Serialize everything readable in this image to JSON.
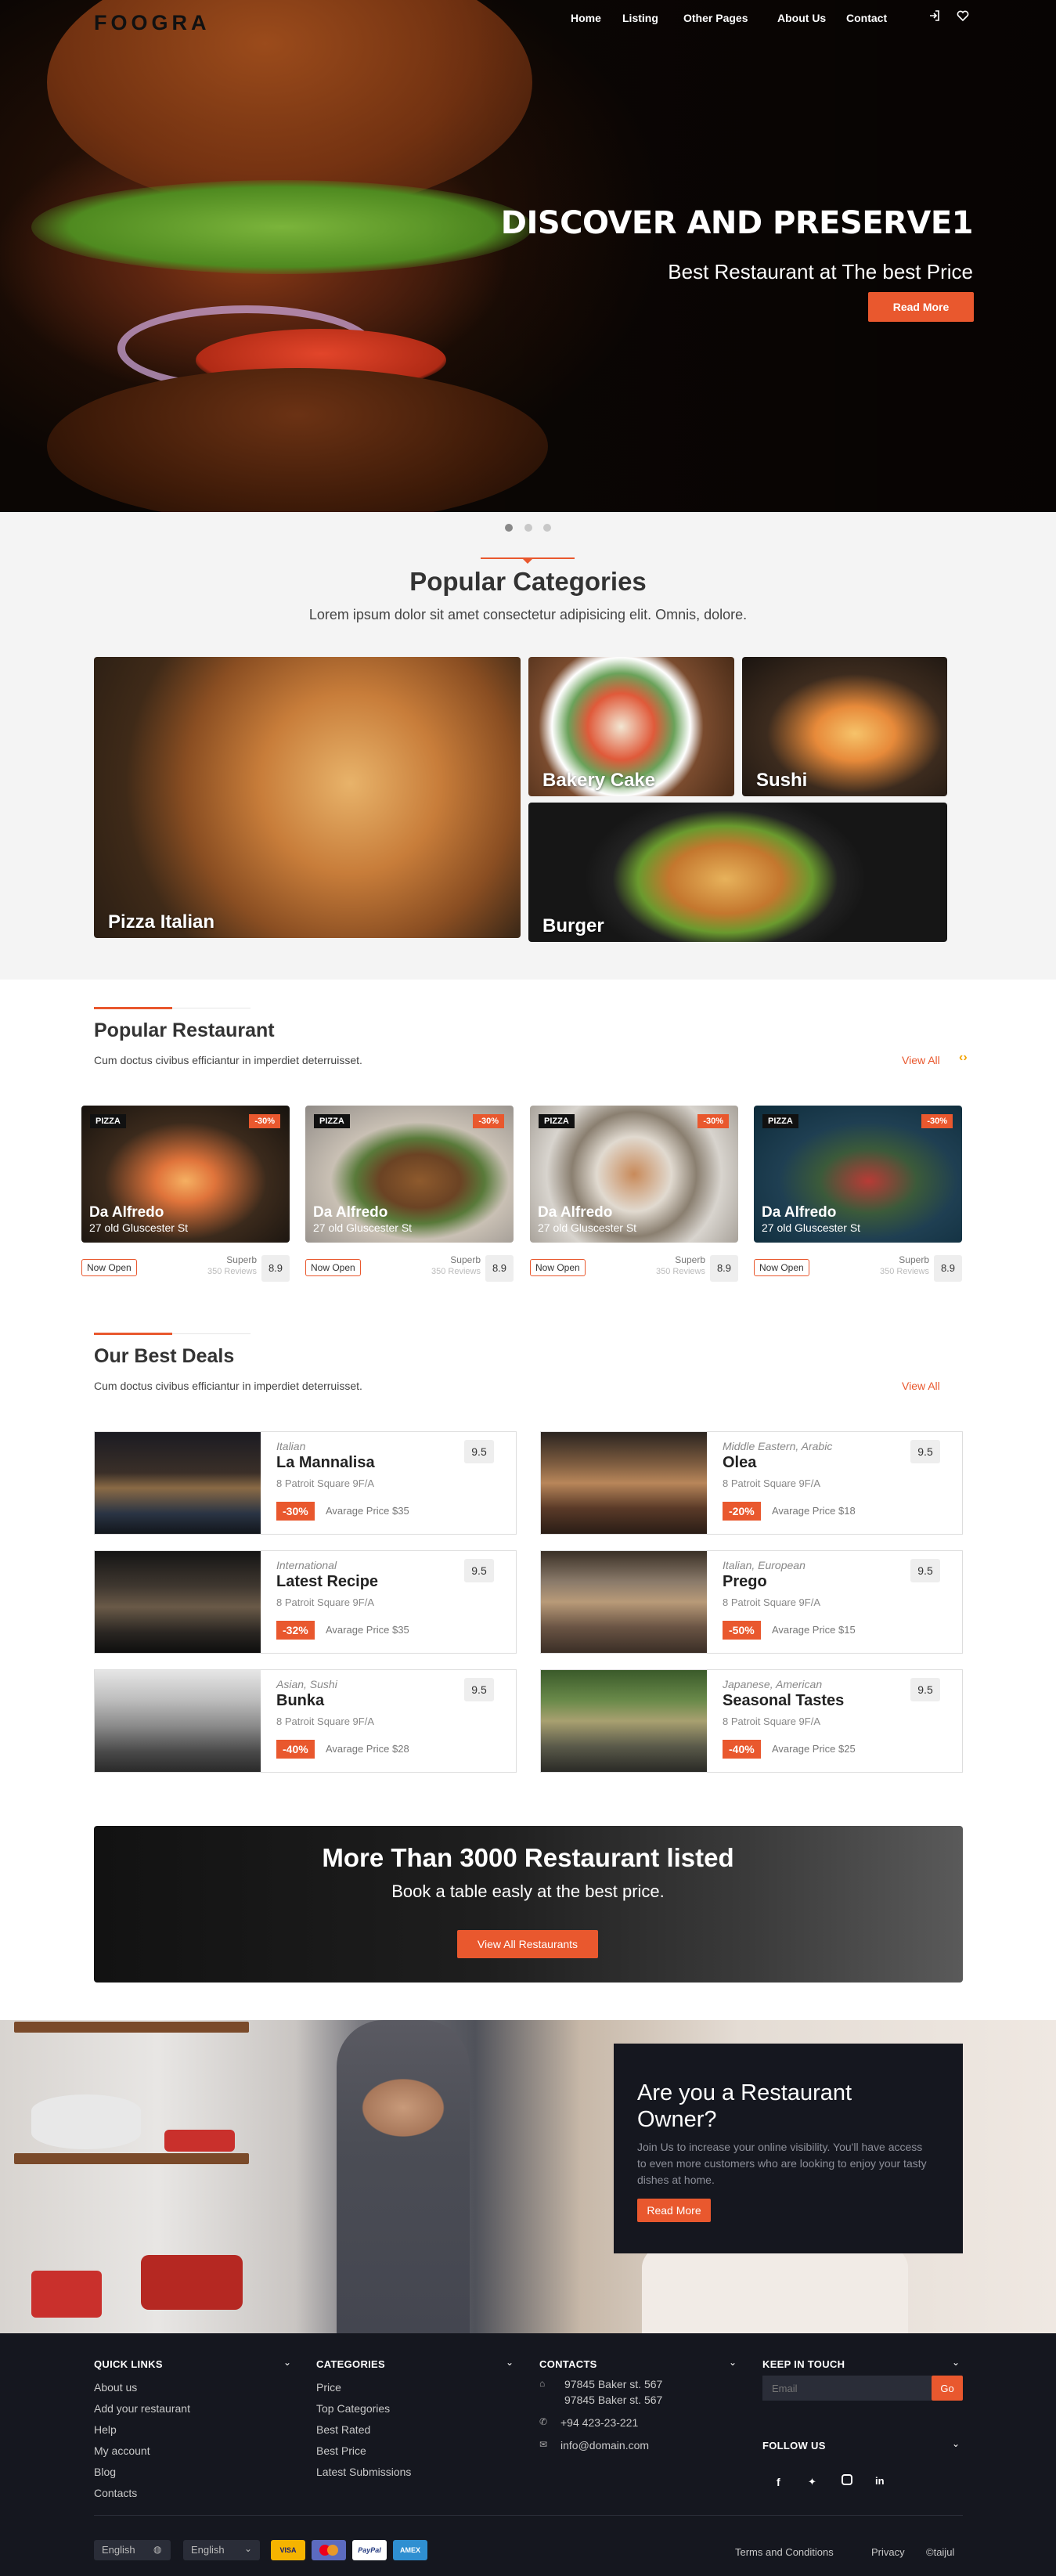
{
  "brand": "FOOGRA",
  "nav": {
    "items": [
      "Home",
      "Listing",
      "Other Pages",
      "About Us",
      "Contact"
    ]
  },
  "hero": {
    "title": "DISCOVER AND PRESERVE1",
    "subtitle": "Best Restaurant at The best Price",
    "button": "Read More"
  },
  "categories": {
    "title": "Popular Categories",
    "subtitle": "Lorem ipsum dolor sit amet consectetur adipisicing elit. Omnis, dolore.",
    "tiles": [
      "Pizza Italian",
      "Bakery Cake",
      "Sushi",
      "Burger"
    ]
  },
  "popular": {
    "title": "Popular Restaurant",
    "subtitle": "Cum doctus civibus efficiantur in imperdiet deterruisset.",
    "view_all": "View All",
    "cards": [
      {
        "tag": "PIZZA",
        "discount": "-30%",
        "name": "Da Alfredo",
        "address": "27 old Gluscester St",
        "status": "Now Open",
        "quality": "Superb",
        "reviews": "350 Reviews",
        "score": "8.9"
      },
      {
        "tag": "PIZZA",
        "discount": "-30%",
        "name": "Da Alfredo",
        "address": "27 old Gluscester St",
        "status": "Now Open",
        "quality": "Superb",
        "reviews": "350 Reviews",
        "score": "8.9"
      },
      {
        "tag": "PIZZA",
        "discount": "-30%",
        "name": "Da Alfredo",
        "address": "27 old Gluscester St",
        "status": "Now Open",
        "quality": "Superb",
        "reviews": "350 Reviews",
        "score": "8.9"
      },
      {
        "tag": "PIZZA",
        "discount": "-30%",
        "name": "Da Alfredo",
        "address": "27 old Gluscester St",
        "status": "Now Open",
        "quality": "Superb",
        "reviews": "350 Reviews",
        "score": "8.9"
      }
    ]
  },
  "deals": {
    "title": "Our Best Deals",
    "subtitle": "Cum doctus civibus efficiantur in imperdiet deterruisset.",
    "view_all": "View All",
    "items": [
      {
        "category": "Italian",
        "name": "La Mannalisa",
        "address": "8 Patroit Square 9F/A",
        "discount": "-30%",
        "price": "Avarage Price $35",
        "score": "9.5"
      },
      {
        "category": "Middle Eastern, Arabic",
        "name": "Olea",
        "address": "8 Patroit Square 9F/A",
        "discount": "-20%",
        "price": "Avarage Price $18",
        "score": "9.5"
      },
      {
        "category": "International",
        "name": "Latest Recipe",
        "address": "8 Patroit Square 9F/A",
        "discount": "-32%",
        "price": "Avarage Price $35",
        "score": "9.5"
      },
      {
        "category": "Italian, European",
        "name": "Prego",
        "address": "8 Patroit Square 9F/A",
        "discount": "-50%",
        "price": "Avarage Price $15",
        "score": "9.5"
      },
      {
        "category": "Asian, Sushi",
        "name": "Bunka",
        "address": "8 Patroit Square 9F/A",
        "discount": "-40%",
        "price": "Avarage Price $28",
        "score": "9.5"
      },
      {
        "category": "Japanese, American",
        "name": "Seasonal Tastes",
        "address": "8 Patroit Square 9F/A",
        "discount": "-40%",
        "price": "Avarage Price $25",
        "score": "9.5"
      }
    ]
  },
  "banner": {
    "title": "More Than 3000 Restaurant listed",
    "subtitle": "Book a table easly at the best price.",
    "button": "View All Restaurants"
  },
  "owner": {
    "title": "Are you a Restaurant Owner?",
    "text": "Join Us to increase your online visibility. You'll have access to even more customers who are looking to enjoy your tasty dishes at home.",
    "button": "Read More"
  },
  "footer": {
    "quick_links": {
      "title": "QUICK LINKS",
      "items": [
        "About us",
        "Add your restaurant",
        "Help",
        "My account",
        "Blog",
        "Contacts"
      ]
    },
    "categories": {
      "title": "CATEGORIES",
      "items": [
        "Price",
        "Top Categories",
        "Best Rated",
        "Best Price",
        "Latest Submissions"
      ]
    },
    "contacts": {
      "title": "CONTACTS",
      "address1": "97845 Baker st. 567",
      "address2": "97845 Baker st. 567",
      "phone": "+94 423-23-221",
      "email": "info@domain.com"
    },
    "keep_in_touch": {
      "title": "KEEP IN TOUCH",
      "placeholder": "Email",
      "button": "Go"
    },
    "follow_us": {
      "title": "FOLLOW US",
      "icons": [
        "facebook-icon",
        "twitter-icon",
        "instagram-icon",
        "linkedin-icon"
      ]
    },
    "language": "English",
    "language2": "English",
    "payments": [
      "VISA",
      "MasterCard",
      "PayPal",
      "AMEX"
    ],
    "links": [
      "Terms and Conditions",
      "Privacy"
    ],
    "copyright": "©taijul"
  },
  "colors": {
    "accent": "#e9582e",
    "dark": "#15171f"
  }
}
